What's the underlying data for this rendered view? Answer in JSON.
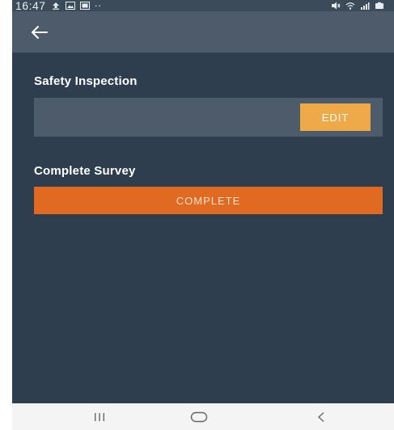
{
  "status_bar": {
    "time": "16:47",
    "extra": "··"
  },
  "header": {
    "back_icon": "arrow-left-icon"
  },
  "inspection": {
    "title": "Safety Inspection",
    "edit_label": "EDIT"
  },
  "survey": {
    "title": "Complete Survey",
    "complete_label": "COMPLETE"
  },
  "nav": {
    "recent_icon": "recent-apps-icon",
    "home_icon": "home-icon",
    "back_icon": "back-icon"
  },
  "colors": {
    "background": "#2e3e4e",
    "app_bar": "#4d5b6a",
    "edit_button": "#eea948",
    "complete_button": "#e06a21",
    "nav_bar": "#f4f4f4"
  }
}
